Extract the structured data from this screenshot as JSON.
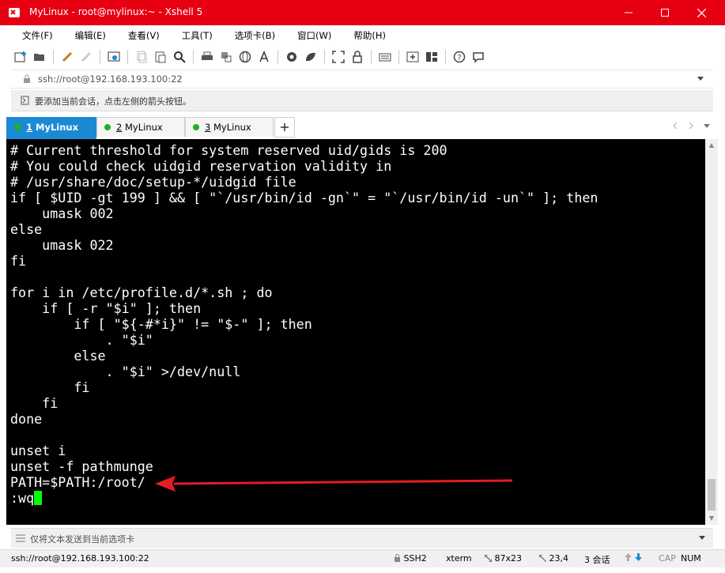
{
  "window": {
    "title": "MyLinux - root@mylinux:~ - Xshell 5",
    "controls": {
      "minimize": "—",
      "maximize": "☐",
      "close": "✕"
    },
    "colors": {
      "titlebar": "#e60012",
      "active_tab": "#1a8ad4",
      "terminal_bg": "#000000",
      "terminal_fg": "#ffffff",
      "cursor": "#00ff00",
      "arrow": "#e51c23",
      "tab_dot": "#19b51f"
    }
  },
  "menu": {
    "items": [
      "文件(F)",
      "编辑(E)",
      "查看(V)",
      "工具(T)",
      "选项卡(B)",
      "窗口(W)",
      "帮助(H)"
    ]
  },
  "toolbar": {
    "icons": [
      "new-session-icon",
      "open-folder-icon",
      "reconnect-icon",
      "disconnect-icon",
      "properties-icon",
      "copy-icon",
      "paste-icon",
      "find-icon",
      "print-icon",
      "transfer-icon",
      "globe-icon",
      "font-icon",
      "xftp-icon",
      "xmanager-icon",
      "fullscreen-icon",
      "lock-icon",
      "keyboard-icon",
      "add-tab-icon",
      "layout-icon",
      "help-icon",
      "chat-icon"
    ]
  },
  "address": {
    "value": "ssh://root@192.168.193.100:22"
  },
  "hint": {
    "text": "要添加当前会话，点击左侧的箭头按钮。"
  },
  "tabs": [
    {
      "num": "1",
      "label": " MyLinux",
      "active": true
    },
    {
      "num": "2",
      "label": " MyLinux",
      "active": false
    },
    {
      "num": "3",
      "label": " MyLinux",
      "active": false
    }
  ],
  "terminal": {
    "lines": [
      "# Current threshold for system reserved uid/gids is 200",
      "# You could check uidgid reservation validity in",
      "# /usr/share/doc/setup-*/uidgid file",
      "if [ $UID -gt 199 ] && [ \"`/usr/bin/id -gn`\" = \"`/usr/bin/id -un`\" ]; then",
      "    umask 002",
      "else",
      "    umask 022",
      "fi",
      "",
      "for i in /etc/profile.d/*.sh ; do",
      "    if [ -r \"$i\" ]; then",
      "        if [ \"${-#*i}\" != \"$-\" ]; then",
      "            . \"$i\"",
      "        else",
      "            . \"$i\" >/dev/null",
      "        fi",
      "    fi",
      "done",
      "",
      "unset i",
      "unset -f pathmunge",
      "PATH=$PATH:/root/",
      ":wq"
    ]
  },
  "sendbar": {
    "text": "仅将文本发送到当前选项卡"
  },
  "status": {
    "connection": "ssh://root@192.168.193.100:22",
    "protocol": "SSH2",
    "terminal_type": "xterm",
    "size": "87x23",
    "position": "23,4",
    "sessions": "3 会话",
    "cap": "CAP",
    "num": "NUM"
  }
}
